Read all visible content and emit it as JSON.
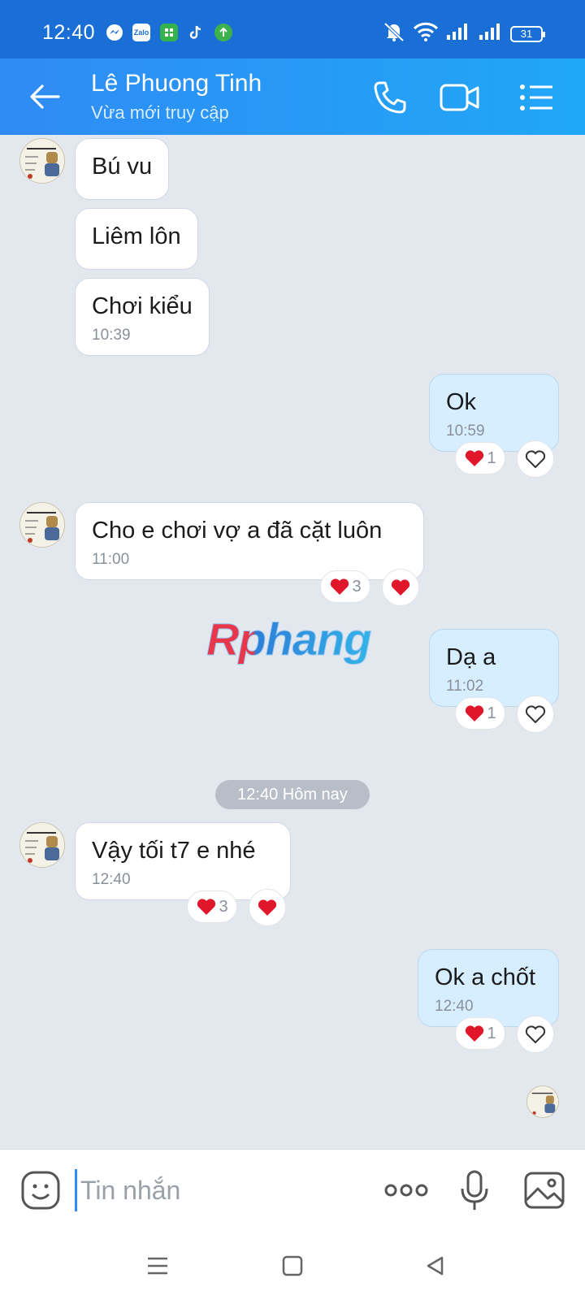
{
  "status_bar": {
    "time": "12:40",
    "battery": "31",
    "apps": [
      {
        "icon": "messenger-icon",
        "color": "#ffffff"
      },
      {
        "icon": "zalo-icon",
        "color": "#ffffff",
        "label": "Zalo"
      },
      {
        "icon": "app-green-icon",
        "color": "#35b24a"
      },
      {
        "icon": "tiktok-icon",
        "color": "#ffffff"
      },
      {
        "icon": "upload-app-icon",
        "color": "#3cb34a"
      }
    ]
  },
  "header": {
    "name": "Lê Phuong Tinh",
    "status": "Vừa mới truy cập",
    "color_start": "#2f8bf4",
    "color_end": "#20a7f7"
  },
  "messages": [
    {
      "side": "in",
      "text": "Bú vu"
    },
    {
      "side": "in",
      "text": "Liêm lôn"
    },
    {
      "side": "in",
      "text": "Chơi kiểu",
      "time": "10:39"
    },
    {
      "side": "out",
      "text": "Ok",
      "time": "10:59",
      "reaction_count": "1"
    },
    {
      "side": "in",
      "text": "Cho e chơi vợ a đã cặt luôn",
      "time": "11:00",
      "reaction_count": "3"
    },
    {
      "side": "out",
      "text": "Dạ a",
      "time": "11:02",
      "reaction_count": "1"
    },
    {
      "side": "in",
      "text": "Vậy tối t7 e nhé",
      "time": "12:40",
      "reaction_count": "3"
    },
    {
      "side": "out",
      "text": "Ok a chốt",
      "time": "12:40",
      "reaction_count": "1"
    }
  ],
  "date_separator": "12:40 Hôm nay",
  "watermark": "Rphang",
  "composer": {
    "placeholder": "Tin nhắn"
  },
  "colors": {
    "chat_bg": "#e3e8ef",
    "outgoing_bubble": "#d6eeff",
    "incoming_bubble": "#ffffff",
    "heart": "#e0162b"
  }
}
